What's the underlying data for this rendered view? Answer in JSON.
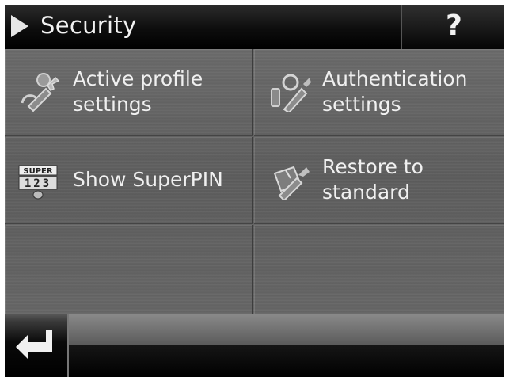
{
  "header": {
    "title": "Security",
    "help_label": "?"
  },
  "menu": {
    "items": [
      {
        "line1": "Active profile",
        "line2": "settings",
        "icon": "wrench-person-icon"
      },
      {
        "line1": "Authentication",
        "line2": "settings",
        "icon": "key-wrench-icon"
      },
      {
        "line1": "Show SuperPIN",
        "icon": "superpin-icon",
        "icon_text": "SUPER",
        "icon_digits": "123"
      },
      {
        "line1": "Restore to",
        "line2": "standard",
        "icon": "restore-wrench-icon"
      }
    ]
  },
  "footer": {
    "back_icon": "return-arrow-icon"
  },
  "colors": {
    "header_bg": "#000000",
    "panel_bg": "#636363",
    "text": "#f0f0f0"
  }
}
